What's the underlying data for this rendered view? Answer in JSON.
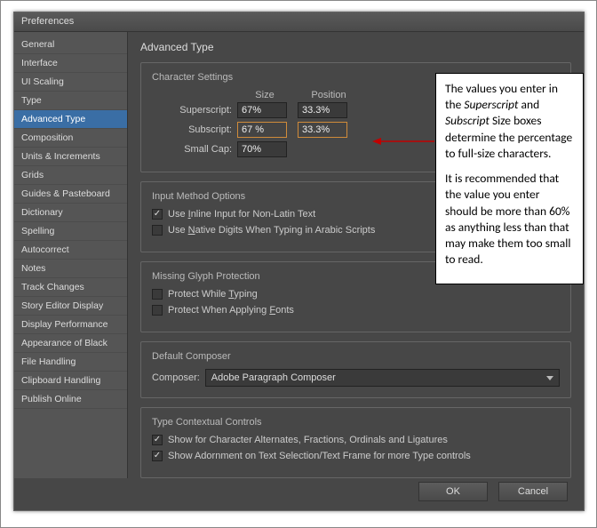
{
  "window": {
    "title": "Preferences"
  },
  "sidebar": {
    "items": [
      {
        "label": "General"
      },
      {
        "label": "Interface"
      },
      {
        "label": "UI Scaling"
      },
      {
        "label": "Type"
      },
      {
        "label": "Advanced Type",
        "selected": true
      },
      {
        "label": "Composition"
      },
      {
        "label": "Units & Increments"
      },
      {
        "label": "Grids"
      },
      {
        "label": "Guides & Pasteboard"
      },
      {
        "label": "Dictionary"
      },
      {
        "label": "Spelling"
      },
      {
        "label": "Autocorrect"
      },
      {
        "label": "Notes"
      },
      {
        "label": "Track Changes"
      },
      {
        "label": "Story Editor Display"
      },
      {
        "label": "Display Performance"
      },
      {
        "label": "Appearance of Black"
      },
      {
        "label": "File Handling"
      },
      {
        "label": "Clipboard Handling"
      },
      {
        "label": "Publish Online"
      }
    ]
  },
  "main": {
    "heading": "Advanced Type",
    "char": {
      "title": "Character Settings",
      "col_size": "Size",
      "col_position": "Position",
      "superscript_label": "Superscript:",
      "superscript_size": "67%",
      "superscript_pos": "33.3%",
      "subscript_label": "Subscript:",
      "subscript_size": "67 %",
      "subscript_pos": "33.3%",
      "smallcap_label": "Small Cap:",
      "smallcap_size": "70%"
    },
    "ime": {
      "title": "Input Method Options",
      "opt1_pre": "Use ",
      "opt1_und": "I",
      "opt1_post": "nline Input for Non-Latin Text",
      "opt1_checked": true,
      "opt2_pre": "Use ",
      "opt2_und": "N",
      "opt2_post": "ative Digits When Typing in Arabic Scripts",
      "opt2_checked": false
    },
    "glyph": {
      "title": "Missing Glyph Protection",
      "opt1_pre": "Protect While ",
      "opt1_und": "T",
      "opt1_post": "yping",
      "opt1_checked": false,
      "opt2_pre": "Protect When Applying ",
      "opt2_und": "F",
      "opt2_post": "onts",
      "opt2_checked": false
    },
    "composer": {
      "title": "Default Composer",
      "label": "Composer:",
      "value": "Adobe Paragraph Composer"
    },
    "contextual": {
      "title": "Type Contextual Controls",
      "opt1": "Show for Character Alternates, Fractions, Ordinals and Ligatures",
      "opt1_checked": true,
      "opt2": "Show Adornment on Text Selection/Text Frame for more Type controls",
      "opt2_checked": true
    }
  },
  "buttons": {
    "ok": "OK",
    "cancel": "Cancel"
  },
  "callout": {
    "p1a": "The values you enter in the ",
    "p1b": "Superscript",
    "p1c": " and ",
    "p1d": "Subscript",
    "p1e": " Size boxes determine the percentage to full-size characters.",
    "p2": "It is recommended that the value you enter should be more than 60% as anything less than that may make them too small to read."
  }
}
